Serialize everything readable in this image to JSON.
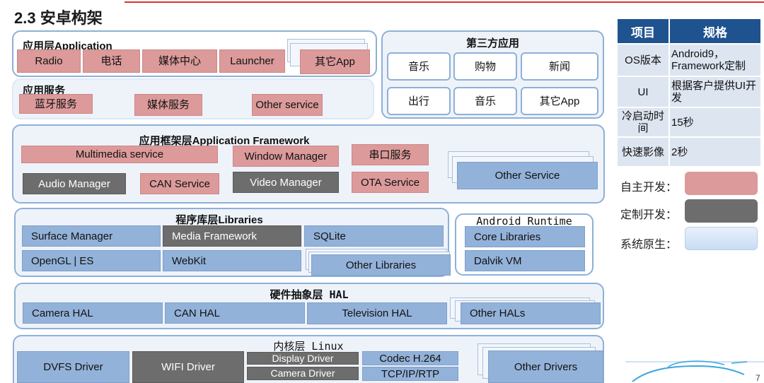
{
  "title": "2.3 安卓构架",
  "app_layer": {
    "title": "应用层Application",
    "items": [
      "Radio",
      "电话",
      "媒体中心",
      "Launcher",
      "其它App"
    ]
  },
  "app_service": {
    "title": "应用服务",
    "items": [
      "蓝牙服务",
      "媒体服务",
      "Other service"
    ]
  },
  "third_party": {
    "title": "第三方应用",
    "items": [
      "音乐",
      "购物",
      "新闻",
      "出行",
      "音乐",
      "其它App"
    ]
  },
  "framework": {
    "title": "应用框架层Application Framework",
    "items": [
      "Multimedia service",
      "Window Manager",
      "串口服务",
      "Audio Manager",
      "CAN Service",
      "Video Manager",
      "OTA Service",
      "Other Service"
    ]
  },
  "libraries": {
    "title": "程序库层Libraries",
    "items": [
      "Surface Manager",
      "Media Framework",
      "SQLite",
      "OpenGL | ES",
      "WebKit",
      "Other Libraries"
    ]
  },
  "runtime": {
    "title": "Android Runtime",
    "items": [
      "Core Libraries",
      "Dalvik VM"
    ]
  },
  "hal": {
    "title": "硬件抽象层 HAL",
    "items": [
      "Camera HAL",
      "CAN HAL",
      "Television HAL",
      "Other HALs"
    ]
  },
  "kernel": {
    "title": "内核层 Linux",
    "items": [
      "DVFS Driver",
      "WIFI Driver",
      "Display Driver",
      "Camera Driver",
      "Codec H.264",
      "TCP/IP/RTP",
      "Other Drivers"
    ]
  },
  "spec_table": {
    "headers": [
      "项目",
      "规格"
    ],
    "rows": [
      [
        "OS版本",
        "Android9，Framework定制"
      ],
      [
        "UI",
        "根据客户提供UI开发"
      ],
      [
        "冷启动时间",
        "15秒"
      ],
      [
        "快速影像",
        "2秒"
      ]
    ]
  },
  "legend": {
    "items": [
      {
        "label": "自主开发：",
        "color": "#dc9a9a"
      },
      {
        "label": "定制开发：",
        "color": "#6d6d6d"
      },
      {
        "label": "系统原生：",
        "color": "#c9dcf6"
      }
    ]
  },
  "page_number": "7"
}
